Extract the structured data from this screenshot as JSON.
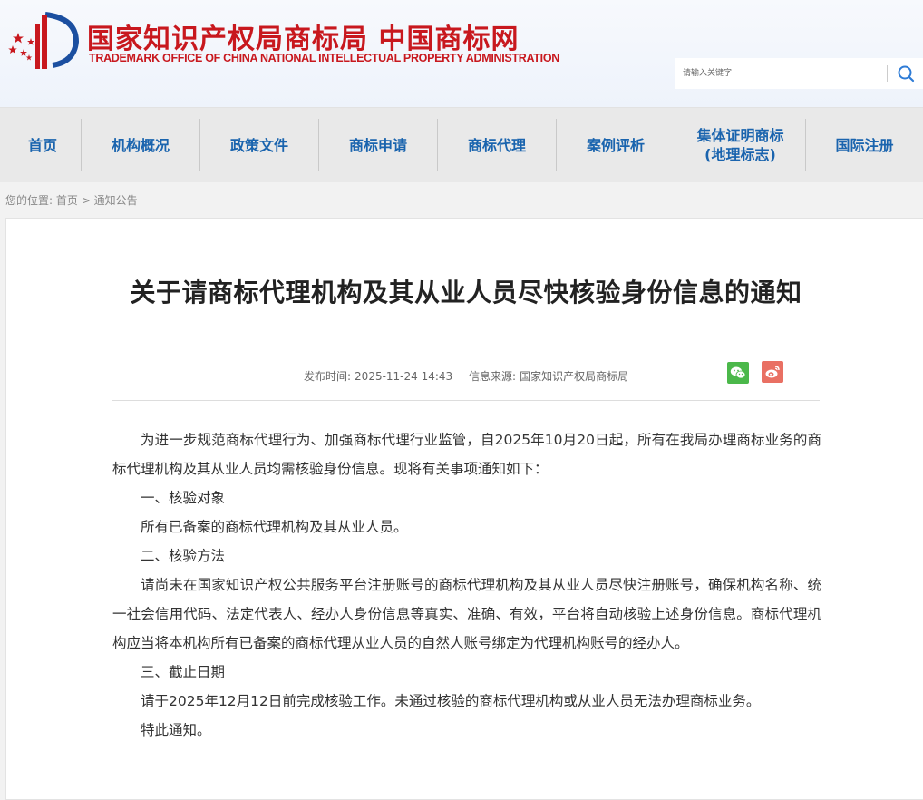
{
  "header": {
    "title_cn": "国家知识产权局商标局 中国商标网",
    "title_en": "TRADEMARK OFFICE OF CHINA NATIONAL INTELLECTUAL PROPERTY ADMINISTRATION",
    "search_placeholder": "请输入关键字",
    "search_icon": "search-icon",
    "logo_icon": "cnipa-emblem-icon"
  },
  "nav": {
    "items": [
      {
        "label": "首页"
      },
      {
        "label": "机构概况"
      },
      {
        "label": "政策文件"
      },
      {
        "label": "商标申请"
      },
      {
        "label": "商标代理"
      },
      {
        "label": "案例评析"
      },
      {
        "label": "集体证明商标\n(地理标志)"
      },
      {
        "label": "国际注册"
      }
    ]
  },
  "breadcrumb": {
    "prefix": "您的位置:",
    "home": "首页",
    "sep": ">",
    "current": "通知公告"
  },
  "article": {
    "title": "关于请商标代理机构及其从业人员尽快核验身份信息的通知",
    "publish_label": "发布时间:",
    "publish_time": "2025-11-24 14:43",
    "source_label": "信息来源:",
    "source": "国家知识产权局商标局",
    "share_icons": [
      "wechat-icon",
      "weibo-icon"
    ],
    "paragraphs": [
      "为进一步规范商标代理行为、加强商标代理行业监管，自2025年10月20日起，所有在我局办理商标业务的商标代理机构及其从业人员均需核验身份信息。现将有关事项通知如下：",
      "一、核验对象",
      "所有已备案的商标代理机构及其从业人员。",
      "二、核验方法",
      "请尚未在国家知识产权公共服务平台注册账号的商标代理机构及其从业人员尽快注册账号，确保机构名称、统一社会信用代码、法定代表人、经办人身份信息等真实、准确、有效，平台将自动核验上述身份信息。商标代理机构应当将本机构所有已备案的商标代理从业人员的自然人账号绑定为代理机构账号的经办人。",
      "三、截止日期",
      "请于2025年12月12日前完成核验工作。未通过核验的商标代理机构或从业人员无法办理商标业务。",
      "特此通知。"
    ]
  },
  "colors": {
    "brand_red": "#c8181e",
    "nav_blue": "#1a64ae",
    "nav_bg": "#e9e9e9",
    "wechat_green": "#4bb84a",
    "weibo_red": "#e97063"
  }
}
